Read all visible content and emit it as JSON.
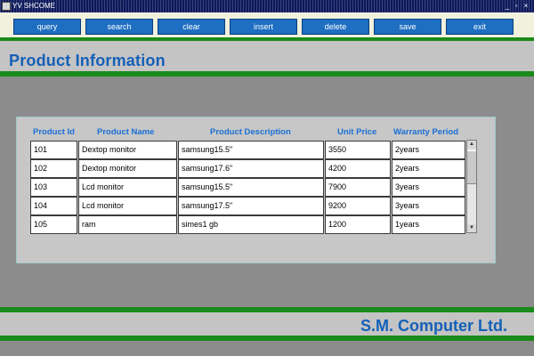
{
  "window": {
    "title": "YV SHCOME"
  },
  "toolbar": {
    "buttons": [
      "query",
      "search",
      "clear",
      "insert",
      "delete",
      "save",
      "exit"
    ]
  },
  "page_title": "Product Information",
  "table": {
    "headers": [
      "Product Id",
      "Product Name",
      "Product Description",
      "Unit Price",
      "Warranty Period"
    ],
    "rows": [
      [
        "101",
        "Dextop monitor",
        "samsung15.5\"",
        "3550",
        "2years"
      ],
      [
        "102",
        "Dextop monitor",
        "samsung17.6\"",
        "4200",
        "2years"
      ],
      [
        "103",
        "Lcd monitor",
        "samsung15.5\"",
        "7900",
        "3years"
      ],
      [
        "104",
        "Lcd monitor",
        "samsung17.5\"",
        "9200",
        "3years"
      ],
      [
        "105",
        "ram",
        "simes1 gb",
        "1200",
        "1years"
      ]
    ]
  },
  "footer": {
    "company": "S.M. Computer Ltd."
  },
  "colors": {
    "brand_blue": "#1560b8",
    "accent_green": "#1a8b1a",
    "button_blue": "#1e6ec2"
  }
}
